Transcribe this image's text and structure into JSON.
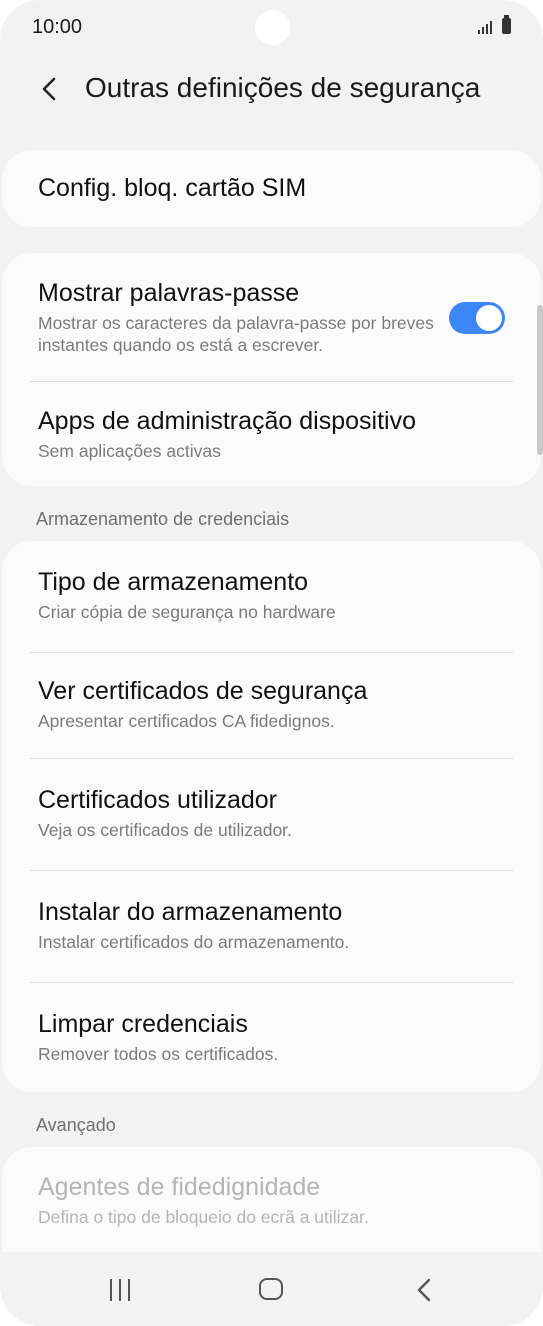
{
  "status": {
    "time": "10:00"
  },
  "header": {
    "title": "Outras definições de segurança"
  },
  "sim_card": {
    "title": "Config. bloq. cartão SIM"
  },
  "general": {
    "show_passwords": {
      "title": "Mostrar palavras-passe",
      "subtitle": "Mostrar os caracteres da palavra-passe por breves instantes quando os está a escrever.",
      "enabled": true
    },
    "device_admin": {
      "title": "Apps de administração dispositivo",
      "subtitle": "Sem aplicações activas"
    }
  },
  "credential_storage": {
    "header": "Armazenamento de credenciais",
    "items": [
      {
        "title": "Tipo de armazenamento",
        "subtitle": "Criar cópia de segurança no hardware"
      },
      {
        "title": "Ver certificados de segurança",
        "subtitle": "Apresentar certificados CA fidedignos."
      },
      {
        "title": "Certificados utilizador",
        "subtitle": "Veja os certificados de utilizador."
      },
      {
        "title": "Instalar do armazenamento",
        "subtitle": "Instalar certificados do armazenamento."
      },
      {
        "title": "Limpar credenciais",
        "subtitle": "Remover todos os certificados."
      }
    ]
  },
  "advanced": {
    "header": "Avançado",
    "trust_agents": {
      "title": "Agentes de fidedignidade",
      "subtitle": "Defina o tipo de bloqueio do ecrã a utilizar.",
      "disabled": true
    }
  },
  "colors": {
    "accent": "#3d86f5",
    "background": "#f2f2f2",
    "card": "#fbfbfb"
  }
}
